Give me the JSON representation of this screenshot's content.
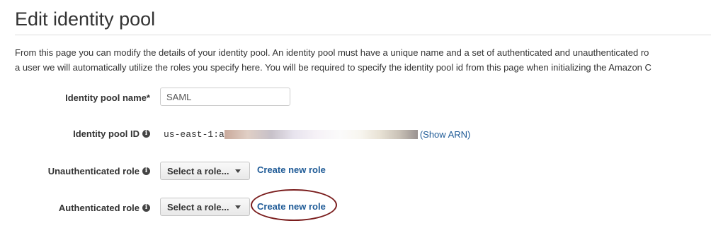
{
  "page": {
    "title": "Edit identity pool",
    "description_lines": [
      "From this page you can modify the details of your identity pool. An identity pool must have a unique name and a set of authenticated and unauthenticated ro",
      "a user we will automatically utilize the roles you specify here. You will be required to specify the identity pool id from this page when initializing the Amazon C"
    ]
  },
  "form": {
    "pool_name": {
      "label": "Identity pool name*",
      "value": "SAML"
    },
    "pool_id": {
      "label": "Identity pool ID",
      "value_prefix": "us-east-1:a",
      "show_arn_label": "(Show ARN)"
    },
    "unauth_role": {
      "label": "Unauthenticated role",
      "select_label": "Select a role...",
      "create_link": "Create new role"
    },
    "auth_role": {
      "label": "Authenticated role",
      "select_label": "Select a role...",
      "create_link": "Create new role"
    }
  },
  "icons": {
    "info": "i"
  },
  "colors": {
    "link": "#1e5a96",
    "highlight": "#7a1d1d"
  }
}
